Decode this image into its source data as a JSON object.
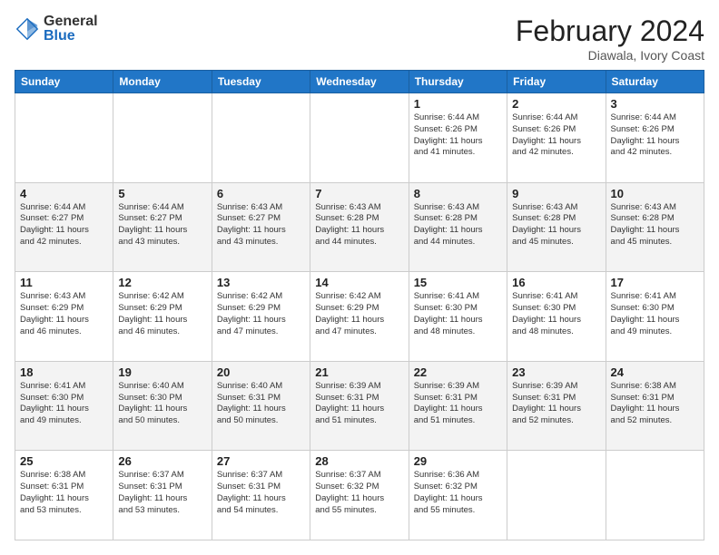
{
  "header": {
    "logo_general": "General",
    "logo_blue": "Blue",
    "month_title": "February 2024",
    "location": "Diawala, Ivory Coast"
  },
  "weekdays": [
    "Sunday",
    "Monday",
    "Tuesday",
    "Wednesday",
    "Thursday",
    "Friday",
    "Saturday"
  ],
  "weeks": [
    [
      {
        "day": "",
        "info": ""
      },
      {
        "day": "",
        "info": ""
      },
      {
        "day": "",
        "info": ""
      },
      {
        "day": "",
        "info": ""
      },
      {
        "day": "1",
        "info": "Sunrise: 6:44 AM\nSunset: 6:26 PM\nDaylight: 11 hours\nand 41 minutes."
      },
      {
        "day": "2",
        "info": "Sunrise: 6:44 AM\nSunset: 6:26 PM\nDaylight: 11 hours\nand 42 minutes."
      },
      {
        "day": "3",
        "info": "Sunrise: 6:44 AM\nSunset: 6:26 PM\nDaylight: 11 hours\nand 42 minutes."
      }
    ],
    [
      {
        "day": "4",
        "info": "Sunrise: 6:44 AM\nSunset: 6:27 PM\nDaylight: 11 hours\nand 42 minutes."
      },
      {
        "day": "5",
        "info": "Sunrise: 6:44 AM\nSunset: 6:27 PM\nDaylight: 11 hours\nand 43 minutes."
      },
      {
        "day": "6",
        "info": "Sunrise: 6:43 AM\nSunset: 6:27 PM\nDaylight: 11 hours\nand 43 minutes."
      },
      {
        "day": "7",
        "info": "Sunrise: 6:43 AM\nSunset: 6:28 PM\nDaylight: 11 hours\nand 44 minutes."
      },
      {
        "day": "8",
        "info": "Sunrise: 6:43 AM\nSunset: 6:28 PM\nDaylight: 11 hours\nand 44 minutes."
      },
      {
        "day": "9",
        "info": "Sunrise: 6:43 AM\nSunset: 6:28 PM\nDaylight: 11 hours\nand 45 minutes."
      },
      {
        "day": "10",
        "info": "Sunrise: 6:43 AM\nSunset: 6:28 PM\nDaylight: 11 hours\nand 45 minutes."
      }
    ],
    [
      {
        "day": "11",
        "info": "Sunrise: 6:43 AM\nSunset: 6:29 PM\nDaylight: 11 hours\nand 46 minutes."
      },
      {
        "day": "12",
        "info": "Sunrise: 6:42 AM\nSunset: 6:29 PM\nDaylight: 11 hours\nand 46 minutes."
      },
      {
        "day": "13",
        "info": "Sunrise: 6:42 AM\nSunset: 6:29 PM\nDaylight: 11 hours\nand 47 minutes."
      },
      {
        "day": "14",
        "info": "Sunrise: 6:42 AM\nSunset: 6:29 PM\nDaylight: 11 hours\nand 47 minutes."
      },
      {
        "day": "15",
        "info": "Sunrise: 6:41 AM\nSunset: 6:30 PM\nDaylight: 11 hours\nand 48 minutes."
      },
      {
        "day": "16",
        "info": "Sunrise: 6:41 AM\nSunset: 6:30 PM\nDaylight: 11 hours\nand 48 minutes."
      },
      {
        "day": "17",
        "info": "Sunrise: 6:41 AM\nSunset: 6:30 PM\nDaylight: 11 hours\nand 49 minutes."
      }
    ],
    [
      {
        "day": "18",
        "info": "Sunrise: 6:41 AM\nSunset: 6:30 PM\nDaylight: 11 hours\nand 49 minutes."
      },
      {
        "day": "19",
        "info": "Sunrise: 6:40 AM\nSunset: 6:30 PM\nDaylight: 11 hours\nand 50 minutes."
      },
      {
        "day": "20",
        "info": "Sunrise: 6:40 AM\nSunset: 6:31 PM\nDaylight: 11 hours\nand 50 minutes."
      },
      {
        "day": "21",
        "info": "Sunrise: 6:39 AM\nSunset: 6:31 PM\nDaylight: 11 hours\nand 51 minutes."
      },
      {
        "day": "22",
        "info": "Sunrise: 6:39 AM\nSunset: 6:31 PM\nDaylight: 11 hours\nand 51 minutes."
      },
      {
        "day": "23",
        "info": "Sunrise: 6:39 AM\nSunset: 6:31 PM\nDaylight: 11 hours\nand 52 minutes."
      },
      {
        "day": "24",
        "info": "Sunrise: 6:38 AM\nSunset: 6:31 PM\nDaylight: 11 hours\nand 52 minutes."
      }
    ],
    [
      {
        "day": "25",
        "info": "Sunrise: 6:38 AM\nSunset: 6:31 PM\nDaylight: 11 hours\nand 53 minutes."
      },
      {
        "day": "26",
        "info": "Sunrise: 6:37 AM\nSunset: 6:31 PM\nDaylight: 11 hours\nand 53 minutes."
      },
      {
        "day": "27",
        "info": "Sunrise: 6:37 AM\nSunset: 6:31 PM\nDaylight: 11 hours\nand 54 minutes."
      },
      {
        "day": "28",
        "info": "Sunrise: 6:37 AM\nSunset: 6:32 PM\nDaylight: 11 hours\nand 55 minutes."
      },
      {
        "day": "29",
        "info": "Sunrise: 6:36 AM\nSunset: 6:32 PM\nDaylight: 11 hours\nand 55 minutes."
      },
      {
        "day": "",
        "info": ""
      },
      {
        "day": "",
        "info": ""
      }
    ]
  ]
}
